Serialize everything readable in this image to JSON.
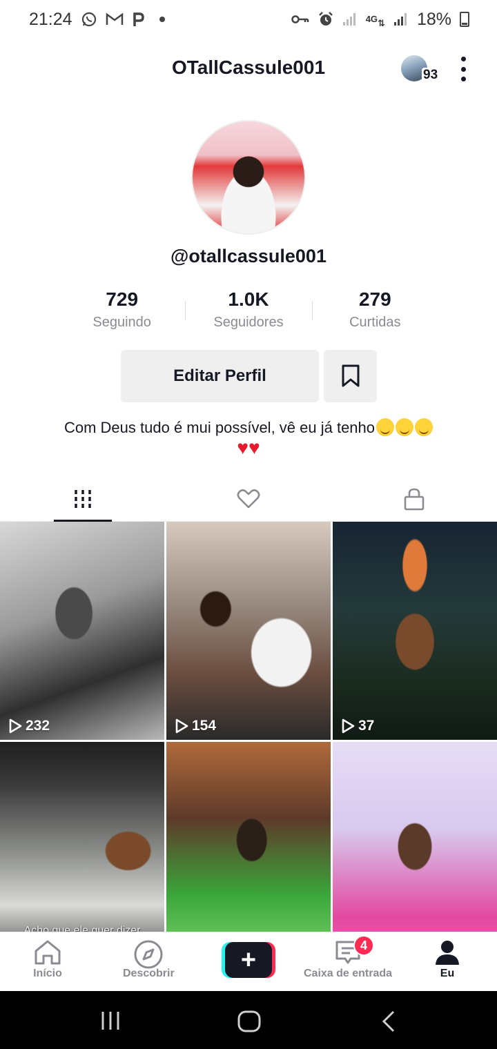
{
  "status_bar": {
    "time": "21:24",
    "battery": "18%",
    "network": "4G"
  },
  "header": {
    "title": "OTallCassule001",
    "notification_count": "93"
  },
  "profile": {
    "handle": "@otallcassule001",
    "stats": [
      {
        "value": "729",
        "label": "Seguindo"
      },
      {
        "value": "1.0K",
        "label": "Seguidores"
      },
      {
        "value": "279",
        "label": "Curtidas"
      }
    ],
    "edit_label": "Editar Perfil",
    "bio": "Com Deus tudo é mui possível, vê eu já tenho"
  },
  "videos": [
    {
      "views": "232"
    },
    {
      "views": "154"
    },
    {
      "views": "37"
    },
    {
      "caption": "Acho que ele quer dizer\nqualquer coisa..."
    },
    {},
    {}
  ],
  "bottom_nav": {
    "home": "Início",
    "discover": "Descobrir",
    "inbox": "Caixa de entrada",
    "inbox_badge": "4",
    "me": "Eu"
  },
  "colors": {
    "accent": "#fe2c55",
    "cyan": "#25f4ee",
    "text": "#161823",
    "muted": "#8a8b91"
  },
  "icons": [
    "whatsapp-icon",
    "gmail-icon",
    "pinterest-icon",
    "key-icon",
    "alarm-icon",
    "signal-icon",
    "battery-icon",
    "kebab-menu-icon",
    "bookmark-icon",
    "grid-icon",
    "heart-icon",
    "lock-icon",
    "play-icon",
    "home-icon",
    "compass-icon",
    "plus-icon",
    "inbox-icon",
    "person-icon"
  ]
}
